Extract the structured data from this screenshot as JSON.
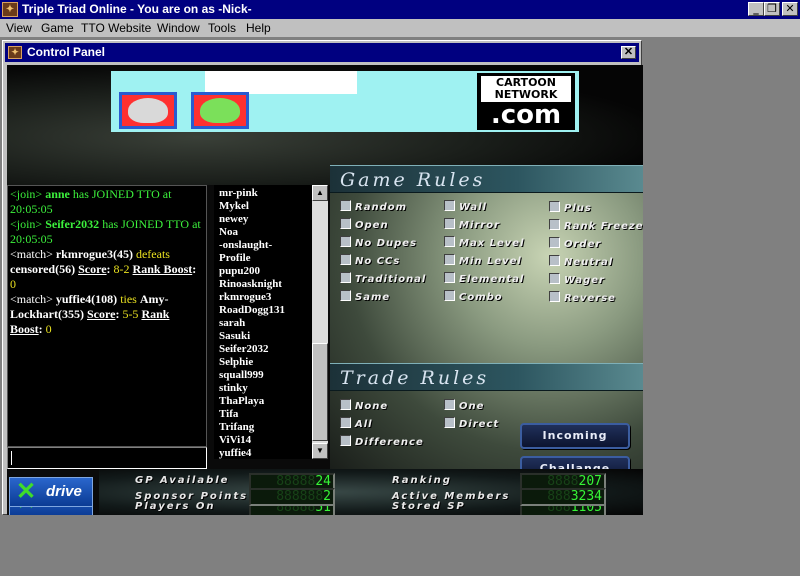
{
  "app": {
    "title": "Triple Triad Online - You are on as -Nick-",
    "icon": "tto-app-icon",
    "window_buttons": [
      "_",
      "❐",
      "✕"
    ]
  },
  "menu": [
    "View",
    "Game",
    "TTO Website",
    "Window",
    "Tools",
    "Help"
  ],
  "control_panel": {
    "title": "Control Panel",
    "close": "✕"
  },
  "banner": {
    "sponsor_line1": "CARTOON NETWORK",
    "sponsor_line2": ".com"
  },
  "chat": {
    "messages": [
      {
        "tag": "<join>",
        "user": "anne",
        "text": " has JOINED TTO at 20:05:05"
      },
      {
        "tag": "<join>",
        "user": "Seifer2032",
        "text": " has JOINED TTO at 20:05:05"
      },
      {
        "tag": "<match>",
        "p1": "rkmrogue3(45)",
        "verb": " defeats ",
        "p2": "censored(56)",
        "score_label": "Score",
        "score": " 8-2 ",
        "boost_label": "Rank Boost",
        "boost": " 0"
      },
      {
        "tag": "<match>",
        "p1": "yuffie4(108)",
        "verb": " ties ",
        "p2": "Amy-Lockhart(355)",
        "score_label": "Score",
        "score": " 5-5 ",
        "boost_label": "Rank Boost",
        "boost": " 0"
      }
    ]
  },
  "users": [
    "mr-pink",
    "Mykel",
    "newey",
    "Noa",
    "-onslaught-",
    "Profile",
    "pupu200",
    "Rinoasknight",
    "rkmrogue3",
    "RoadDogg131",
    "sarah",
    "Sasuki",
    "Seifer2032",
    "Selphie",
    "squall999",
    "stinky",
    "ThaPlaya",
    "Tifa",
    "Trifang",
    "ViVi14",
    "yuffie4"
  ],
  "game_rules": {
    "heading": "Game Rules",
    "col1": [
      "Random",
      "Open",
      "No Dupes",
      "No CCs",
      "Traditional",
      "Same"
    ],
    "col2": [
      "Wall",
      "Mirror",
      "Max Level",
      "Min Level",
      "Elemental",
      "Combo"
    ],
    "col3": [
      "Plus",
      "Rank Freeze",
      "Order",
      "Neutral",
      "Wager",
      "Reverse"
    ]
  },
  "trade_rules": {
    "heading": "Trade Rules",
    "col1": [
      "None",
      "All",
      "Difference"
    ],
    "col2": [
      "One",
      "Direct"
    ]
  },
  "buttons": {
    "incoming": "Incoming",
    "challange": "Challange"
  },
  "stats": {
    "xdrive_label": "drive",
    "gp_available": {
      "label": "GP Available",
      "value": "24"
    },
    "players_on": {
      "label": "Players On",
      "value": "51"
    },
    "sponsor_points": {
      "label": "Sponsor Points",
      "value": "2"
    },
    "ranking": {
      "label": "Ranking",
      "value": "207"
    },
    "stored_sp": {
      "label": "Stored SP",
      "value": "1105"
    },
    "active_members": {
      "label": "Active Members",
      "value": "3234"
    }
  }
}
